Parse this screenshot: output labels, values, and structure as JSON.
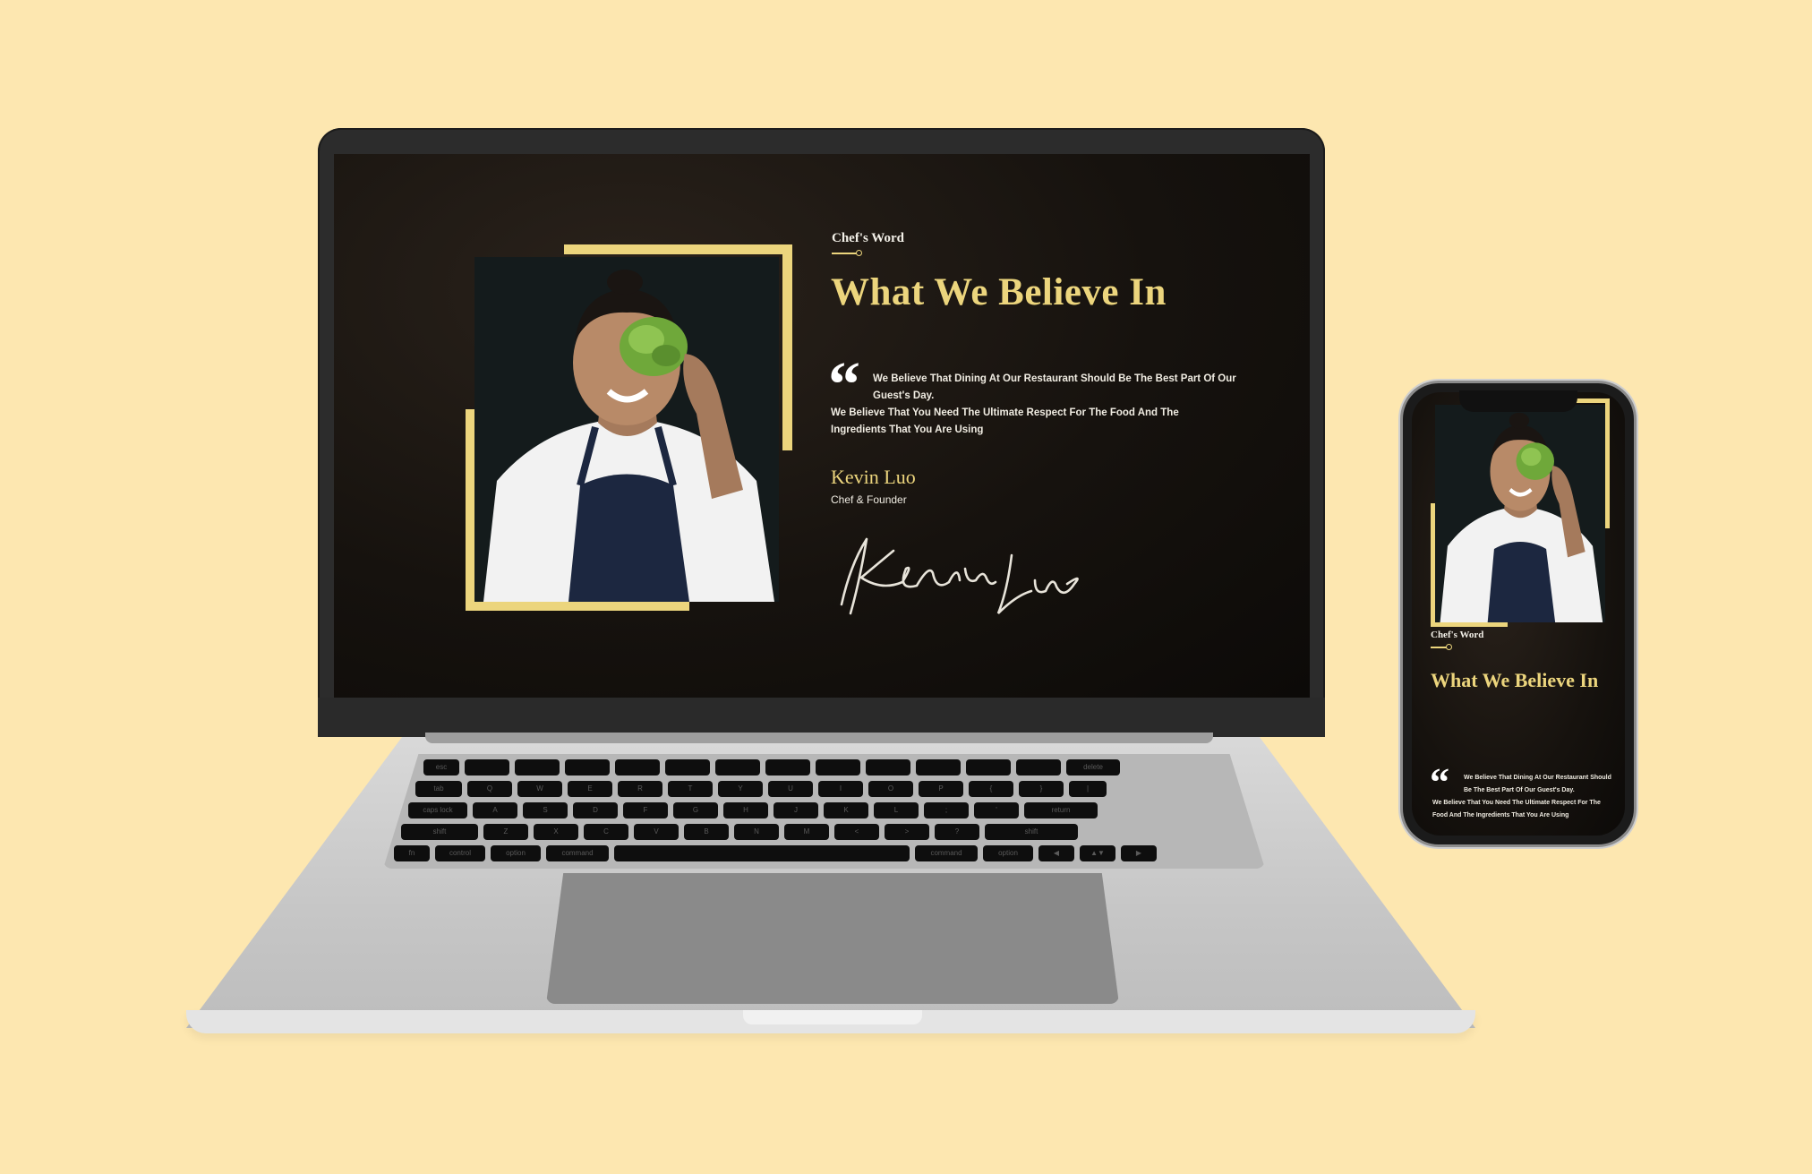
{
  "laptop_page": {
    "eyebrow": "Chef's Word",
    "title": "What We Believe In",
    "quote_line_1": "We Believe That Dining At Our Restaurant Should Be The Best Part Of Our Guest's Day.",
    "quote_line_2": "We Believe That You Need The Ultimate Respect For The Food And The Ingredients That You Are Using",
    "author_name": "Kevin Luo",
    "author_role": "Chef & Founder",
    "signature": "Kevin Luo"
  },
  "phone_page": {
    "eyebrow": "Chef's Word",
    "title": "What We Believe In",
    "quote_line_1": "We Believe That Dining At Our Restaurant Should Be The Best Part Of Our Guest's Day.",
    "quote_line_2": "We Believe That You Need The Ultimate Respect For The Food And The Ingredients That You Are Using"
  },
  "keyboard": {
    "row1": [
      "esc",
      "",
      "",
      "",
      "",
      "",
      "",
      "",
      "",
      "",
      "",
      "",
      "",
      "delete"
    ],
    "row2": [
      "tab",
      "Q",
      "W",
      "E",
      "R",
      "T",
      "Y",
      "U",
      "I",
      "O",
      "P",
      "{",
      "}",
      "|"
    ],
    "row3": [
      "caps lock",
      "A",
      "S",
      "D",
      "F",
      "G",
      "H",
      "J",
      "K",
      "L",
      ";",
      "'",
      "return"
    ],
    "row4": [
      "shift",
      "Z",
      "X",
      "C",
      "V",
      "B",
      "N",
      "M",
      "<",
      ">",
      "?",
      "shift"
    ],
    "row5": [
      "fn",
      "control",
      "option",
      "command",
      "",
      "command",
      "option",
      "◀",
      "▲▼",
      "▶"
    ]
  },
  "colors": {
    "background": "#fde7b0",
    "accent_gold": "#ecd57d",
    "screen_dark": "#16120e"
  }
}
